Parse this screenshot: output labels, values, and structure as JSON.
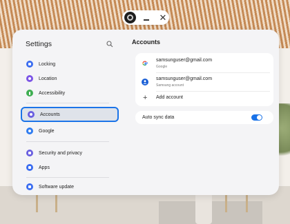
{
  "colors": {
    "accent": "#1a73e8",
    "window_bg": "#f4f4f6",
    "card_bg": "#ffffff"
  },
  "window_controls": {
    "avatar_icon": "app-icon",
    "minimize_icon": "minimize-icon",
    "close_label": "✕"
  },
  "sidebar": {
    "title": "Settings",
    "search_icon": "search-icon",
    "items": [
      {
        "label": "Locking",
        "icon": "lock-icon",
        "color": "#3b6df0"
      },
      {
        "label": "Location",
        "icon": "location-icon",
        "color": "#7c55e6"
      },
      {
        "label": "Accessibility",
        "icon": "accessibility-icon",
        "color": "#3fae52"
      },
      {
        "label": "Accounts",
        "icon": "accounts-icon",
        "color": "#6a5fe0",
        "selected": true
      },
      {
        "label": "Google",
        "icon": "google-icon",
        "color": "#2f7cf0"
      },
      {
        "label": "Security and privacy",
        "icon": "shield-icon",
        "color": "#6a5fe0"
      },
      {
        "label": "Apps",
        "icon": "apps-icon",
        "color": "#3b6df0"
      },
      {
        "label": "Software update",
        "icon": "update-icon",
        "color": "#3b6df0"
      }
    ]
  },
  "panel": {
    "title": "Accounts",
    "accounts": [
      {
        "email": "samsunguser@gmail.com",
        "type": "Google",
        "icon": "google-g-icon"
      },
      {
        "email": "samsunguser@gmail.com",
        "type": "Samsung account",
        "icon": "samsung-account-icon"
      }
    ],
    "add_account_label": "Add account",
    "add_icon": "+",
    "auto_sync_label": "Auto sync data",
    "auto_sync_on": true
  }
}
